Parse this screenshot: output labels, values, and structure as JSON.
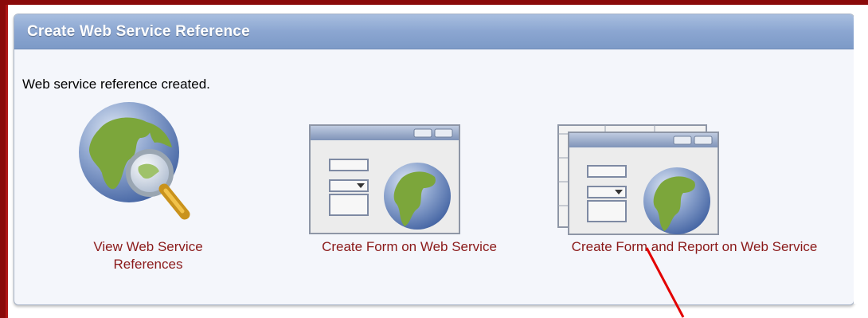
{
  "region": {
    "title": "Create Web Service Reference",
    "message": "Web service reference created."
  },
  "tiles": [
    {
      "label": "View Web Service References",
      "icon": "globe-magnifier-icon"
    },
    {
      "label": "Create Form on Web Service",
      "icon": "form-window-globe-icon"
    },
    {
      "label": "Create Form and Report on Web Service",
      "icon": "stacked-form-report-globe-icon"
    }
  ],
  "colors": {
    "frame": "#8a0a0a",
    "header": "#8ba6d1",
    "link": "#8b1a1a",
    "annotation": "#e30000"
  }
}
